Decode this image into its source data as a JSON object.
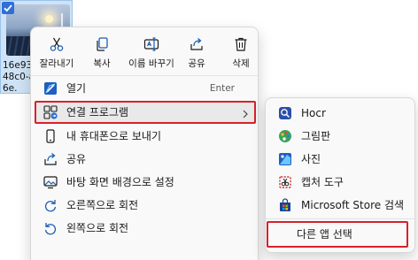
{
  "desktop_file": {
    "name_lines": [
      "16e93c",
      "48c0-a",
      "6e."
    ],
    "checked": true
  },
  "context_menu": {
    "quick_actions": [
      {
        "label": "잘라내기",
        "icon": "scissors-icon"
      },
      {
        "label": "복사",
        "icon": "copy-icon"
      },
      {
        "label": "이름 바꾸기",
        "icon": "rename-icon"
      },
      {
        "label": "공유",
        "icon": "share-icon"
      },
      {
        "label": "삭제",
        "icon": "trash-icon"
      }
    ],
    "items": [
      {
        "label": "열기",
        "shortcut": "Enter",
        "icon": "open-app-icon"
      },
      {
        "label": "연결 프로그램",
        "icon": "open-with-icon",
        "has_submenu": true,
        "highlighted": true
      },
      {
        "label": "내 휴대폰으로 보내기",
        "icon": "phone-icon"
      },
      {
        "label": "공유",
        "icon": "share-icon"
      },
      {
        "label": "바탕 화면 배경으로 설정",
        "icon": "wallpaper-icon"
      },
      {
        "label": "오른쪽으로 회전",
        "icon": "rotate-right-icon"
      },
      {
        "label": "왼쪽으로 회전",
        "icon": "rotate-left-icon"
      }
    ]
  },
  "open_with_submenu": {
    "items": [
      {
        "label": "Hocr",
        "icon": "hocr-app-icon"
      },
      {
        "label": "그림판",
        "icon": "paint-app-icon"
      },
      {
        "label": "사진",
        "icon": "photos-app-icon"
      },
      {
        "label": "캡처 도구",
        "icon": "snipping-tool-icon"
      },
      {
        "label": "Microsoft Store 검색",
        "icon": "store-icon"
      }
    ],
    "choose_other": {
      "label": "다른 앱 선택"
    }
  },
  "colors": {
    "highlight_border": "#d6222a",
    "accent_blue": "#2f6fd6",
    "menu_background": "#f9f9f9"
  }
}
